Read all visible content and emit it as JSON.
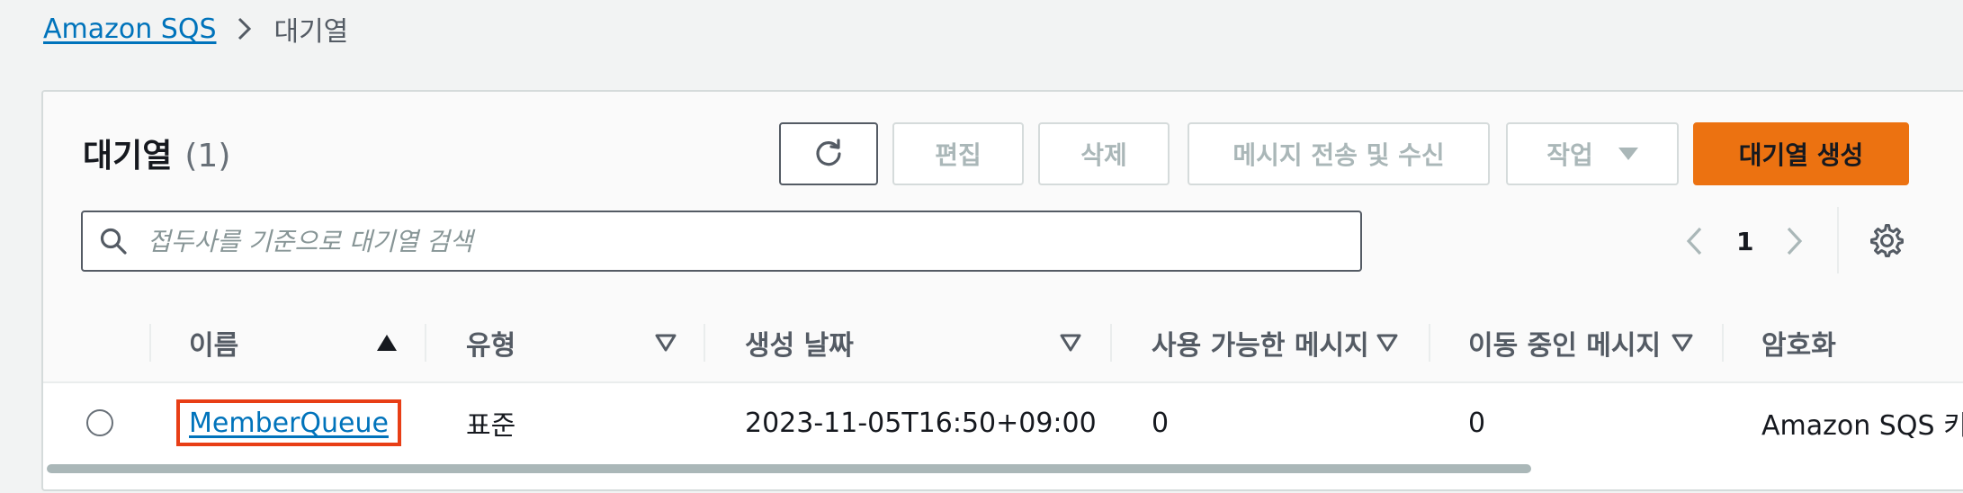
{
  "breadcrumb": {
    "root": "Amazon SQS",
    "current": "대기열"
  },
  "header": {
    "title": "대기열",
    "count": "(1)"
  },
  "toolbar": {
    "refresh_icon": "refresh-icon",
    "edit_label": "편집",
    "delete_label": "삭제",
    "send_receive_label": "메시지 전송 및 수신",
    "actions_label": "작업",
    "create_label": "대기열 생성"
  },
  "search": {
    "placeholder": "접두사를 기준으로 대기열 검색",
    "value": ""
  },
  "pagination": {
    "current_page": "1"
  },
  "table": {
    "columns": [
      {
        "label": "이름",
        "sort": "ascending"
      },
      {
        "label": "유형",
        "sort": "sortable"
      },
      {
        "label": "생성 날짜",
        "sort": "sortable"
      },
      {
        "label": "사용 가능한 메시지",
        "sort": "sortable"
      },
      {
        "label": "이동 중인 메시지",
        "sort": "sortable"
      },
      {
        "label": "암호화",
        "sort": "none"
      }
    ],
    "rows": [
      {
        "name": "MemberQueue",
        "type": "표준",
        "created": "2023-11-05T16:50+09:00",
        "available": "0",
        "in_flight": "0",
        "encryption": "Amazon SQS 키"
      }
    ]
  },
  "colors": {
    "accent": "#ec7211",
    "link": "#0073bb",
    "highlight": "#e83e16"
  }
}
